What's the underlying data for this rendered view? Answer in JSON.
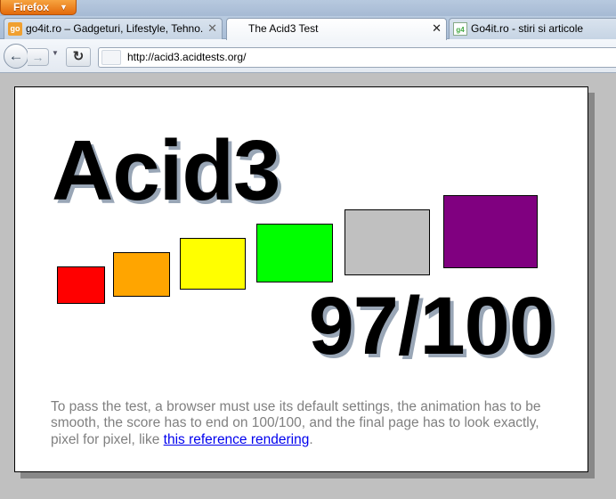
{
  "browser": {
    "app_button": "Firefox",
    "tabs": [
      {
        "title": "go4it.ro – Gadgeturi, Lifestyle, Tehno...",
        "favicon": "go",
        "active": false
      },
      {
        "title": "The Acid3 Test",
        "favicon": "",
        "active": true
      },
      {
        "title": "Go4it.ro - stiri si articole",
        "favicon": "g4",
        "active": false
      }
    ],
    "url": "http://acid3.acidtests.org/"
  },
  "page": {
    "title": "Acid3",
    "score": "97/100",
    "squares": [
      {
        "color": "#ff0000"
      },
      {
        "color": "#ffa500"
      },
      {
        "color": "#ffff00"
      },
      {
        "color": "#00ff00"
      },
      {
        "color": "#c0c0c0"
      },
      {
        "color": "#800080"
      }
    ],
    "instructions_text": "To pass the test, a browser must use its default settings, the animation has to be smooth, the score has to end on 100/100, and the final page has to look exactly, pixel for pixel, like ",
    "reference_link": "this reference rendering",
    "instructions_end": "."
  },
  "colors": {
    "page_background": "#c0c0c0",
    "link": "#0000ee",
    "text_gray": "#808080"
  }
}
